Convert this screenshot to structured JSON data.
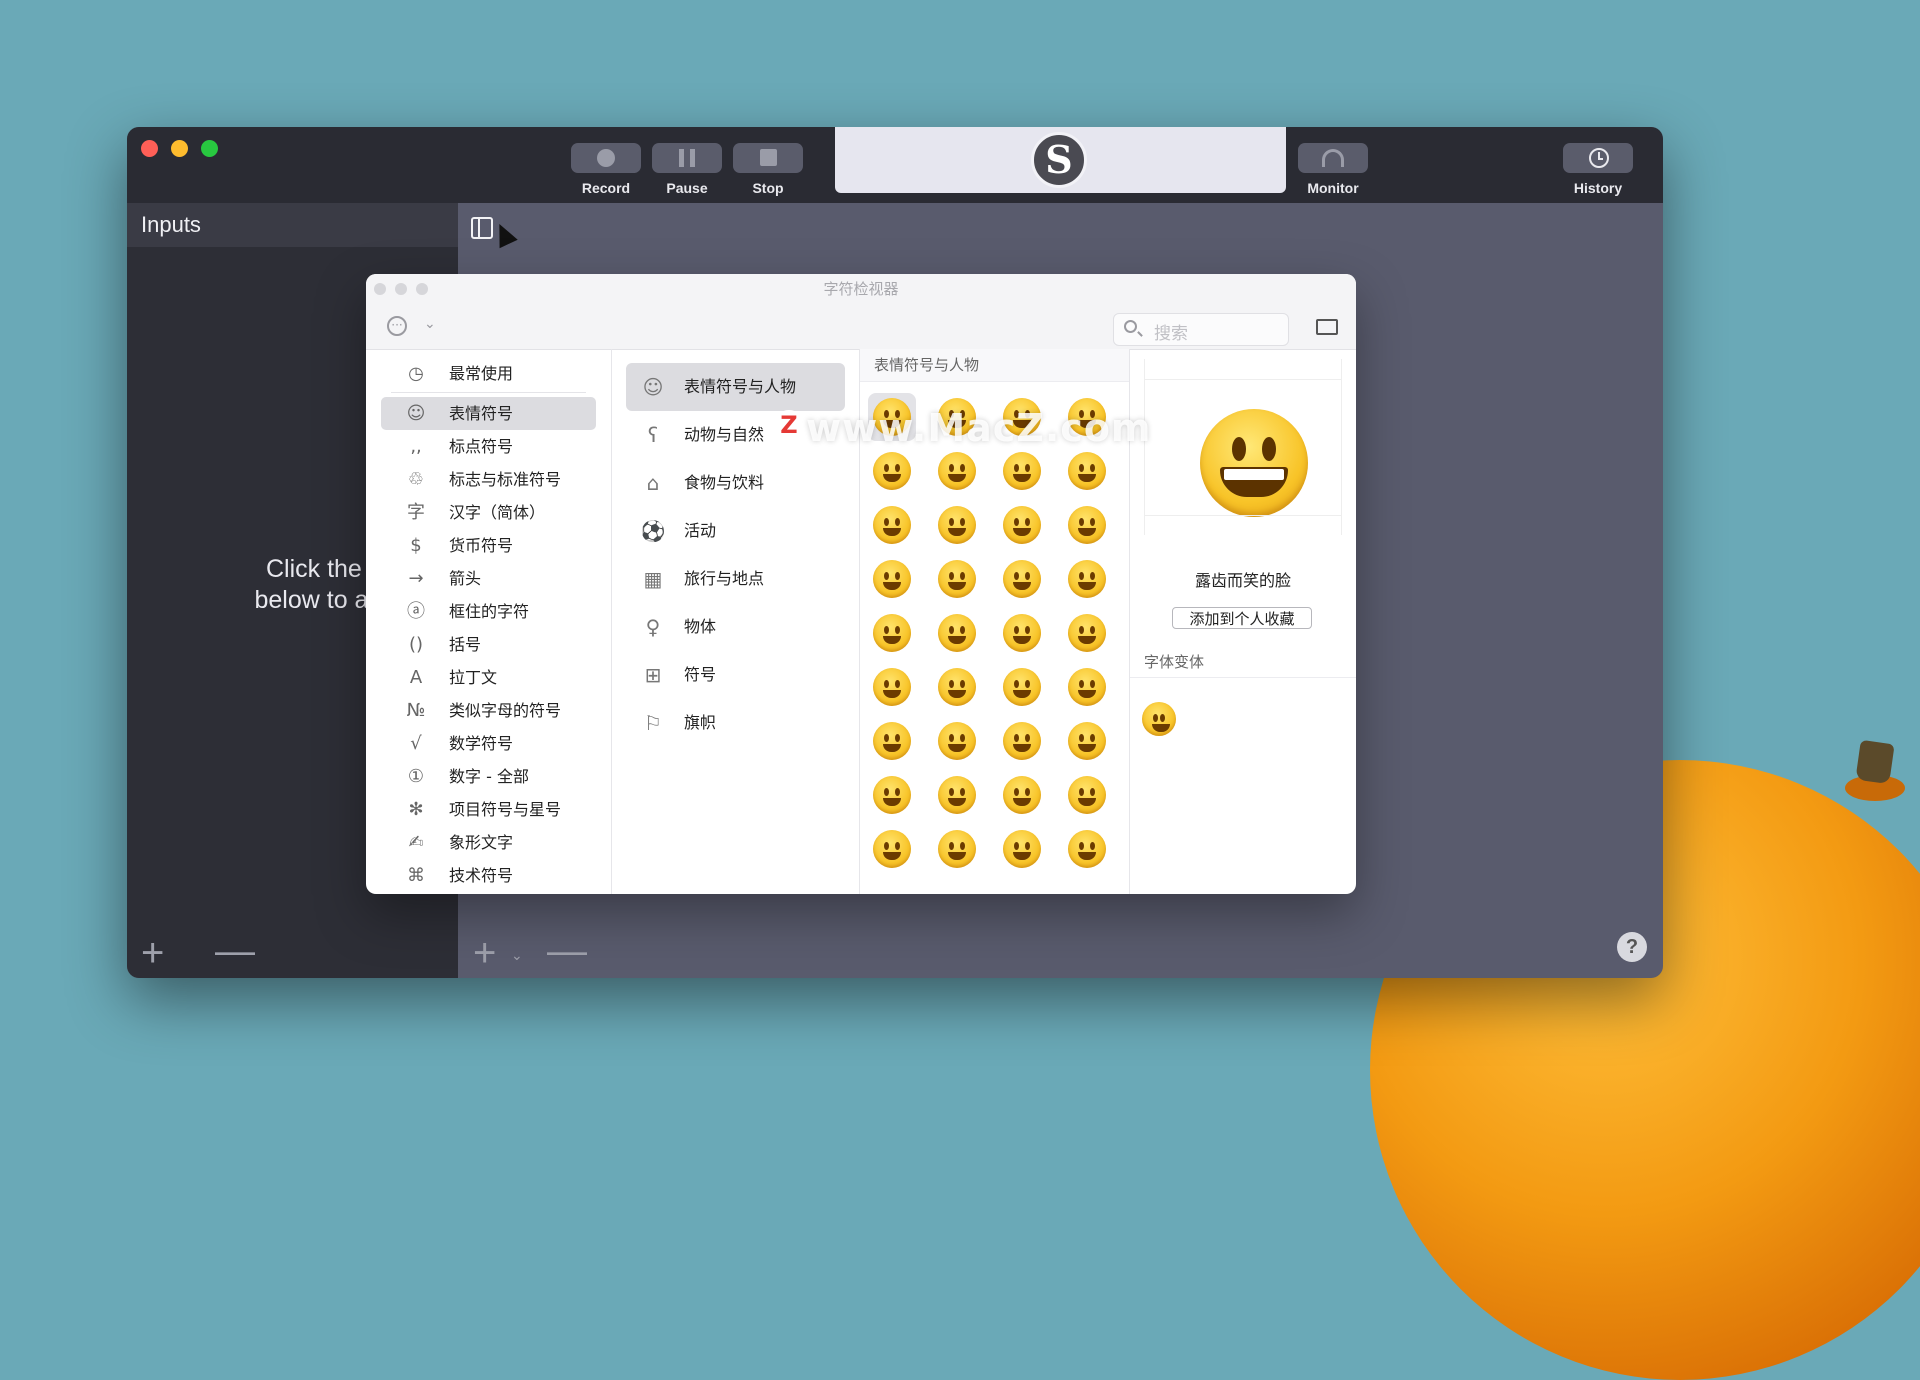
{
  "app": {
    "toolbar": {
      "record_label": "Record",
      "pause_label": "Pause",
      "stop_label": "Stop",
      "monitor_label": "Monitor",
      "history_label": "History"
    },
    "sidebar": {
      "title": "Inputs",
      "hint_line1": "Click the + butt",
      "hint_line2": "below to add an i"
    }
  },
  "character_viewer": {
    "title": "字符检视器",
    "search_placeholder": "搜索",
    "categories": [
      {
        "icon": "clock-icon",
        "glyph": "◷",
        "label": "最常使用"
      },
      {
        "icon": "smiley-icon",
        "glyph": "☺",
        "label": "表情符号"
      },
      {
        "icon": "punctuation-icon",
        "glyph": "‚,",
        "label": "标点符号"
      },
      {
        "icon": "recycle-icon",
        "glyph": "♲",
        "label": "标志与标准符号"
      },
      {
        "icon": "hanzi-icon",
        "glyph": "字",
        "label": "汉字（简体）"
      },
      {
        "icon": "dollar-icon",
        "glyph": "$",
        "label": "货币符号"
      },
      {
        "icon": "arrow-icon",
        "glyph": "→",
        "label": "箭头"
      },
      {
        "icon": "circled-a-icon",
        "glyph": "ⓐ",
        "label": "框住的字符"
      },
      {
        "icon": "parentheses-icon",
        "glyph": "()",
        "label": "括号"
      },
      {
        "icon": "latin-a-icon",
        "glyph": "A",
        "label": "拉丁文"
      },
      {
        "icon": "numero-icon",
        "glyph": "№",
        "label": "类似字母的符号"
      },
      {
        "icon": "sqrt-icon",
        "glyph": "√",
        "label": "数学符号"
      },
      {
        "icon": "circled-one-icon",
        "glyph": "①",
        "label": "数字 - 全部"
      },
      {
        "icon": "asterisk-icon",
        "glyph": "✻",
        "label": "项目符号与星号"
      },
      {
        "icon": "pictograph-icon",
        "glyph": "✍",
        "label": "象形文字"
      },
      {
        "icon": "command-icon",
        "glyph": "⌘",
        "label": "技术符号"
      }
    ],
    "subcategories": [
      {
        "icon": "smiley-icon",
        "glyph": "☺",
        "label": "表情符号与人物"
      },
      {
        "icon": "bear-icon",
        "glyph": "ʕ",
        "label": "动物与自然"
      },
      {
        "icon": "cake-icon",
        "glyph": "⌂",
        "label": "食物与饮料"
      },
      {
        "icon": "soccer-ball-icon",
        "glyph": "⚽",
        "label": "活动"
      },
      {
        "icon": "building-icon",
        "glyph": "▦",
        "label": "旅行与地点"
      },
      {
        "icon": "lightbulb-icon",
        "glyph": "♀",
        "label": "物体"
      },
      {
        "icon": "symbols-icon",
        "glyph": "⊞",
        "label": "符号"
      },
      {
        "icon": "flag-icon",
        "glyph": "⚐",
        "label": "旗帜"
      }
    ],
    "grid_header": "表情符号与人物",
    "emoji_rows": 9,
    "emoji_cols": 4,
    "detail": {
      "name": "露齿而笑的脸",
      "add_favorite": "添加到个人收藏",
      "variants_header": "字体变体"
    }
  },
  "watermark": {
    "badge": "Z",
    "text": "www.MacZ.com"
  }
}
